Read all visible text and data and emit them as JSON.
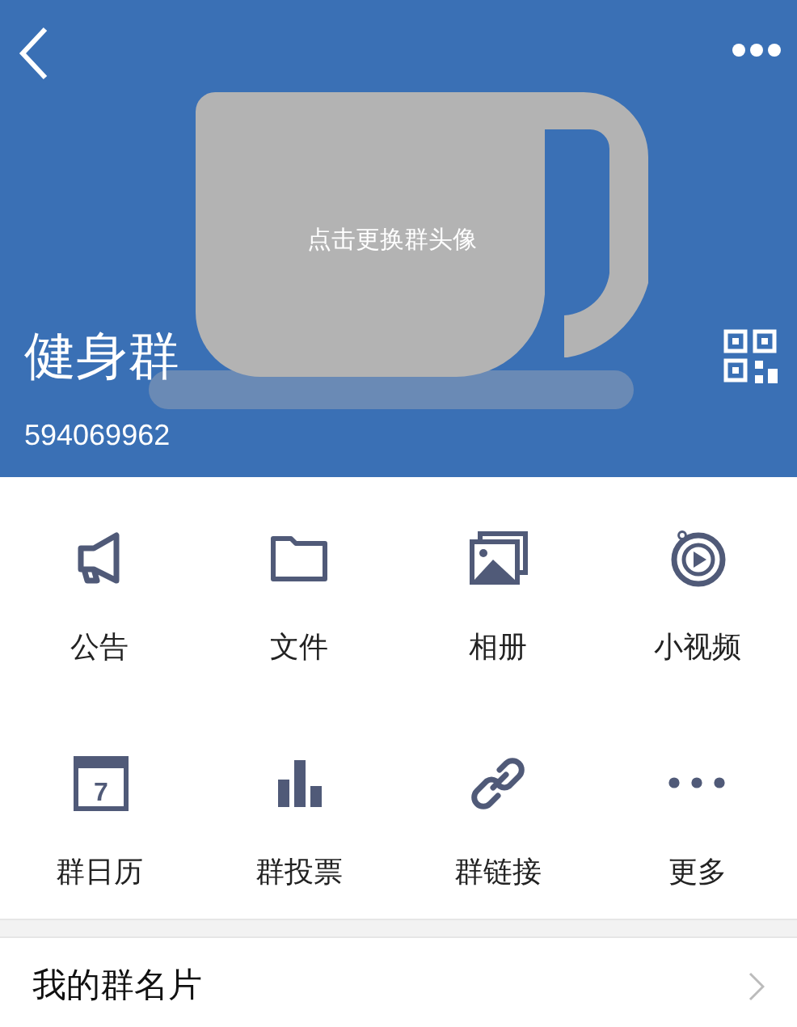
{
  "header": {
    "avatar_hint": "点击更换群头像",
    "group_name": "健身群",
    "group_number": "594069962"
  },
  "features": [
    {
      "kind": "announcement",
      "label": "公告"
    },
    {
      "kind": "files",
      "label": "文件"
    },
    {
      "kind": "album",
      "label": "相册"
    },
    {
      "kind": "video",
      "label": "小视频"
    },
    {
      "kind": "calendar",
      "label": "群日历",
      "icon_text": "7"
    },
    {
      "kind": "vote",
      "label": "群投票"
    },
    {
      "kind": "link",
      "label": "群链接"
    },
    {
      "kind": "more",
      "label": "更多"
    }
  ],
  "my_card": {
    "label": "我的群名片"
  }
}
